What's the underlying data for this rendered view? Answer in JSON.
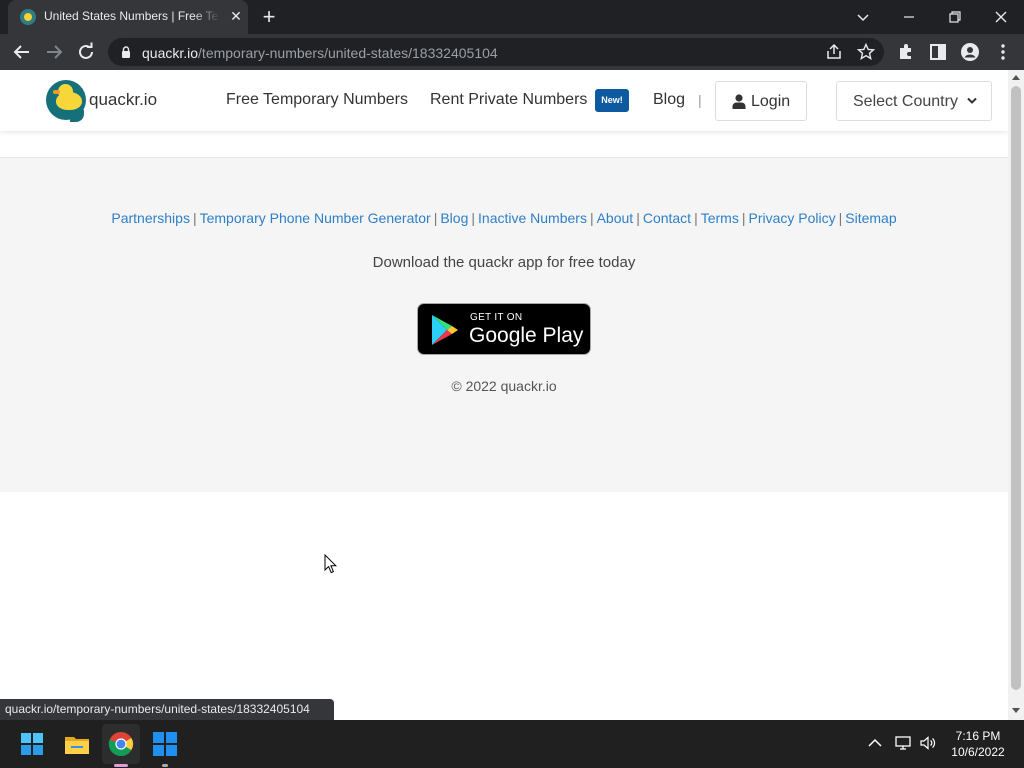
{
  "browser": {
    "tab_title": "United States Numbers | Free Temporary Phone Numbers",
    "tab_close": "✕",
    "new_tab": "+",
    "url_host": "quackr.io",
    "url_path": "/temporary-numbers/united-states/18332405104"
  },
  "site": {
    "logo_text": "quackr.io",
    "nav": {
      "free_numbers": "Free Temporary Numbers",
      "rent_numbers": "Rent Private Numbers",
      "new_badge": "New!",
      "blog": "Blog",
      "separator": "|",
      "login": "Login",
      "select_country": "Select Country"
    },
    "footer": {
      "links": [
        "Partnerships",
        "Temporary Phone Number Generator",
        "Blog",
        "Inactive Numbers",
        "About",
        "Contact",
        "Terms",
        "Privacy Policy",
        "Sitemap"
      ],
      "download_text": "Download the quackr app for free today",
      "badge_small": "GET IT ON",
      "badge_big": "Google Play",
      "copyright": "© 2022 quackr.io"
    }
  },
  "status_bar": {
    "text": "quackr.io/temporary-numbers/united-states/18332405104"
  },
  "taskbar": {
    "time": "7:16 PM",
    "date": "10/6/2022"
  },
  "colors": {
    "brand_teal": "#16707a",
    "duck_yellow": "#f6d73a",
    "link_blue": "#2f7fc7",
    "badge_blue": "#0d5aa0"
  }
}
